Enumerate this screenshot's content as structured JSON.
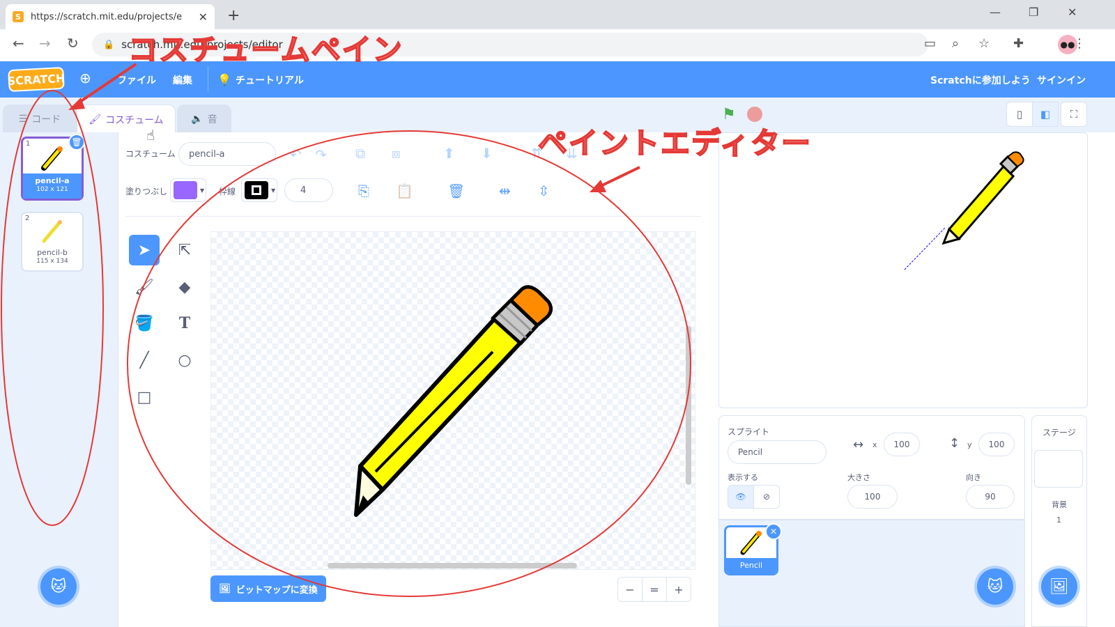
{
  "browser": {
    "tab_title": "https://scratch.mit.edu/projects/e",
    "tab_close": "✕",
    "new_tab": "+",
    "url": "scratch.mit.edu/projects/editor",
    "window_controls": {
      "minimize": "—",
      "maximize": "❐",
      "close": "✕"
    }
  },
  "menubar": {
    "logo": "SCRATCH",
    "file": "ファイル",
    "edit": "編集",
    "tutorial": "チュートリアル",
    "join": "Scratchに参加しよう",
    "signin": "サインイン"
  },
  "editor_tabs": {
    "code": "コード",
    "costumes": "コスチューム",
    "sounds": "音"
  },
  "costumes": [
    {
      "index": "1",
      "name": "pencil-a",
      "size": "102 x 121",
      "selected": true
    },
    {
      "index": "2",
      "name": "pencil-b",
      "size": "115 x 134",
      "selected": false
    }
  ],
  "paint": {
    "costume_label": "コスチューム",
    "costume_name": "pencil-a",
    "fill_label": "塗りつぶし",
    "outline_label": "枠線",
    "outline_width": "4",
    "fill_color": "#9966ff",
    "outline_color": "#000000",
    "bitmap_button": "ビットマップに変換",
    "zoom_out": "−",
    "zoom_reset": "=",
    "zoom_in": "+"
  },
  "sprite": {
    "label": "スプライト",
    "name": "Pencil",
    "x_label": "x",
    "x": "100",
    "y_label": "y",
    "y": "100",
    "show_label": "表示する",
    "size_label": "大きさ",
    "size": "100",
    "direction_label": "向き",
    "direction": "90",
    "tile_name": "Pencil"
  },
  "stage_panel": {
    "label": "ステージ",
    "backdrops_label": "背景",
    "backdrops_count": "1"
  },
  "annotations": {
    "costume_pane": "コスチュームペイン",
    "paint_editor": "ペイントエディター",
    "color": "#e53935"
  }
}
